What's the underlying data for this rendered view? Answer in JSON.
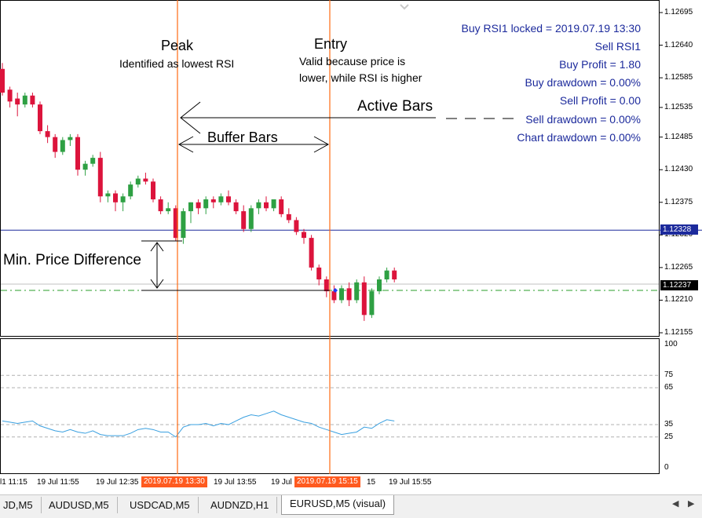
{
  "colors": {
    "bull": "#2ea043",
    "bear": "#dc143c",
    "marker_lines": "#ff6a13",
    "level_line": "#1c2a9c",
    "dashdot_line": "#2a9d2a",
    "rsi_line": "#3aa0e0",
    "info_text": "#1c2a9c"
  },
  "price_axis": {
    "labels": [
      "1.12695",
      "1.12640",
      "1.12585",
      "1.12535",
      "1.12485",
      "1.12430",
      "1.12375",
      "1.12320",
      "1.12265",
      "1.12210",
      "1.12155"
    ],
    "blue_line_price": "1.12328",
    "bid_price": "1.12237"
  },
  "rsi_axis": {
    "labels": [
      "100",
      "75",
      "65",
      "35",
      "25",
      "0"
    ]
  },
  "time_axis": {
    "labels": [
      "l1 11:15",
      "19 Jul 11:55",
      "19 Jul 12:35",
      "19 Jul 13:55",
      "19 Jul 14:35",
      "15",
      "19 Jul 15:55"
    ],
    "highlight_1": "2019.07.19 13:30",
    "highlight_2": "2019.07.19 15:15"
  },
  "info_panel": {
    "line1": "Buy RSI1 locked = 2019.07.19 13:30",
    "line2": "Sell RSI1",
    "line3": "Buy Profit = 1.80",
    "line4": "Buy drawdown = 0.00%",
    "line5": "Sell Profit = 0.00",
    "line6": "Sell drawdown = 0.00%",
    "line7": "Chart drawdown = 0.00%"
  },
  "annotations": {
    "peak_title": "Peak",
    "peak_sub": "Identified as lowest RSI",
    "entry_title": "Entry",
    "entry_sub1": "Valid because price is",
    "entry_sub2": "lower, while RSI is higher",
    "active_bars": "Active Bars",
    "buffer_bars": "Buffer Bars",
    "min_price": "Min. Price Difference"
  },
  "tabs": [
    "JD,M5",
    "AUDUSD,M5",
    "USDCAD,M5",
    "AUDNZD,H1",
    "EURUSD,M5 (visual)"
  ],
  "active_tab_index": 4,
  "chart_data": {
    "type": "candlestick",
    "candles": [
      {
        "o": 1.126,
        "h": 1.1261,
        "l": 1.12555,
        "c": 1.1256
      },
      {
        "o": 1.12565,
        "h": 1.1257,
        "l": 1.12535,
        "c": 1.12545
      },
      {
        "o": 1.1255,
        "h": 1.1256,
        "l": 1.1252,
        "c": 1.1254
      },
      {
        "o": 1.1254,
        "h": 1.1256,
        "l": 1.12535,
        "c": 1.12555
      },
      {
        "o": 1.12555,
        "h": 1.1256,
        "l": 1.12535,
        "c": 1.1254
      },
      {
        "o": 1.1254,
        "h": 1.12545,
        "l": 1.1249,
        "c": 1.12495
      },
      {
        "o": 1.12495,
        "h": 1.12505,
        "l": 1.12475,
        "c": 1.12485
      },
      {
        "o": 1.12485,
        "h": 1.1249,
        "l": 1.1245,
        "c": 1.1246
      },
      {
        "o": 1.1246,
        "h": 1.12485,
        "l": 1.12455,
        "c": 1.1248
      },
      {
        "o": 1.1248,
        "h": 1.1249,
        "l": 1.1247,
        "c": 1.12485
      },
      {
        "o": 1.12485,
        "h": 1.1249,
        "l": 1.1242,
        "c": 1.1243
      },
      {
        "o": 1.1243,
        "h": 1.12445,
        "l": 1.1242,
        "c": 1.1244
      },
      {
        "o": 1.1244,
        "h": 1.12455,
        "l": 1.12435,
        "c": 1.1245
      },
      {
        "o": 1.1245,
        "h": 1.1246,
        "l": 1.12375,
        "c": 1.12385
      },
      {
        "o": 1.12385,
        "h": 1.12395,
        "l": 1.12375,
        "c": 1.1239
      },
      {
        "o": 1.1239,
        "h": 1.12395,
        "l": 1.1236,
        "c": 1.12375
      },
      {
        "o": 1.12375,
        "h": 1.1239,
        "l": 1.1236,
        "c": 1.12385
      },
      {
        "o": 1.12385,
        "h": 1.1241,
        "l": 1.1238,
        "c": 1.12405
      },
      {
        "o": 1.12405,
        "h": 1.1242,
        "l": 1.124,
        "c": 1.12415
      },
      {
        "o": 1.12415,
        "h": 1.12425,
        "l": 1.12405,
        "c": 1.1241
      },
      {
        "o": 1.1241,
        "h": 1.12415,
        "l": 1.12375,
        "c": 1.1238
      },
      {
        "o": 1.1238,
        "h": 1.12385,
        "l": 1.12355,
        "c": 1.1236
      },
      {
        "o": 1.1236,
        "h": 1.12375,
        "l": 1.12355,
        "c": 1.12365
      },
      {
        "o": 1.12365,
        "h": 1.1237,
        "l": 1.1231,
        "c": 1.12315
      },
      {
        "o": 1.12315,
        "h": 1.12365,
        "l": 1.12305,
        "c": 1.1236
      },
      {
        "o": 1.1236,
        "h": 1.12375,
        "l": 1.1234,
        "c": 1.12375
      },
      {
        "o": 1.12375,
        "h": 1.1238,
        "l": 1.12355,
        "c": 1.12365
      },
      {
        "o": 1.12365,
        "h": 1.12385,
        "l": 1.12355,
        "c": 1.1238
      },
      {
        "o": 1.1238,
        "h": 1.12385,
        "l": 1.12365,
        "c": 1.12375
      },
      {
        "o": 1.12375,
        "h": 1.1239,
        "l": 1.1237,
        "c": 1.12385
      },
      {
        "o": 1.12385,
        "h": 1.12395,
        "l": 1.1237,
        "c": 1.12375
      },
      {
        "o": 1.12375,
        "h": 1.1238,
        "l": 1.12355,
        "c": 1.1236
      },
      {
        "o": 1.1236,
        "h": 1.1237,
        "l": 1.12325,
        "c": 1.1233
      },
      {
        "o": 1.1233,
        "h": 1.1237,
        "l": 1.12325,
        "c": 1.12365
      },
      {
        "o": 1.12365,
        "h": 1.1238,
        "l": 1.12355,
        "c": 1.12375
      },
      {
        "o": 1.12375,
        "h": 1.12385,
        "l": 1.1236,
        "c": 1.12365
      },
      {
        "o": 1.12365,
        "h": 1.1238,
        "l": 1.1236,
        "c": 1.1238
      },
      {
        "o": 1.1238,
        "h": 1.12385,
        "l": 1.1235,
        "c": 1.12355
      },
      {
        "o": 1.12355,
        "h": 1.12365,
        "l": 1.1234,
        "c": 1.12345
      },
      {
        "o": 1.12345,
        "h": 1.1235,
        "l": 1.1232,
        "c": 1.12325
      },
      {
        "o": 1.12325,
        "h": 1.1233,
        "l": 1.12305,
        "c": 1.12315
      },
      {
        "o": 1.12315,
        "h": 1.1232,
        "l": 1.1226,
        "c": 1.12265
      },
      {
        "o": 1.12265,
        "h": 1.1227,
        "l": 1.12235,
        "c": 1.12245
      },
      {
        "o": 1.12245,
        "h": 1.1225,
        "l": 1.12215,
        "c": 1.12225
      },
      {
        "o": 1.12225,
        "h": 1.12235,
        "l": 1.12205,
        "c": 1.1221
      },
      {
        "o": 1.1221,
        "h": 1.12235,
        "l": 1.12205,
        "c": 1.1223
      },
      {
        "o": 1.1223,
        "h": 1.1224,
        "l": 1.122,
        "c": 1.1221
      },
      {
        "o": 1.1221,
        "h": 1.12245,
        "l": 1.12205,
        "c": 1.1224
      },
      {
        "o": 1.1224,
        "h": 1.1225,
        "l": 1.12175,
        "c": 1.12185
      },
      {
        "o": 1.12185,
        "h": 1.1223,
        "l": 1.1218,
        "c": 1.12225
      },
      {
        "o": 1.12225,
        "h": 1.1225,
        "l": 1.1222,
        "c": 1.12245
      },
      {
        "o": 1.12245,
        "h": 1.12265,
        "l": 1.1224,
        "c": 1.1226
      },
      {
        "o": 1.1226,
        "h": 1.12265,
        "l": 1.1224,
        "c": 1.12245
      }
    ],
    "rsi": [
      38,
      37,
      36,
      37,
      38,
      34,
      32,
      30,
      29,
      31,
      29,
      28,
      30,
      27,
      26,
      26,
      26,
      28,
      31,
      32,
      31,
      29,
      29,
      25,
      33,
      35,
      35,
      36,
      34,
      36,
      35,
      38,
      41,
      43,
      42,
      44,
      46,
      43,
      41,
      39,
      37,
      36,
      33,
      31,
      29,
      27,
      28,
      29,
      33,
      32,
      36,
      39,
      38
    ],
    "levels": [
      75,
      65,
      35,
      25
    ],
    "ylim": [
      0,
      100
    ]
  }
}
